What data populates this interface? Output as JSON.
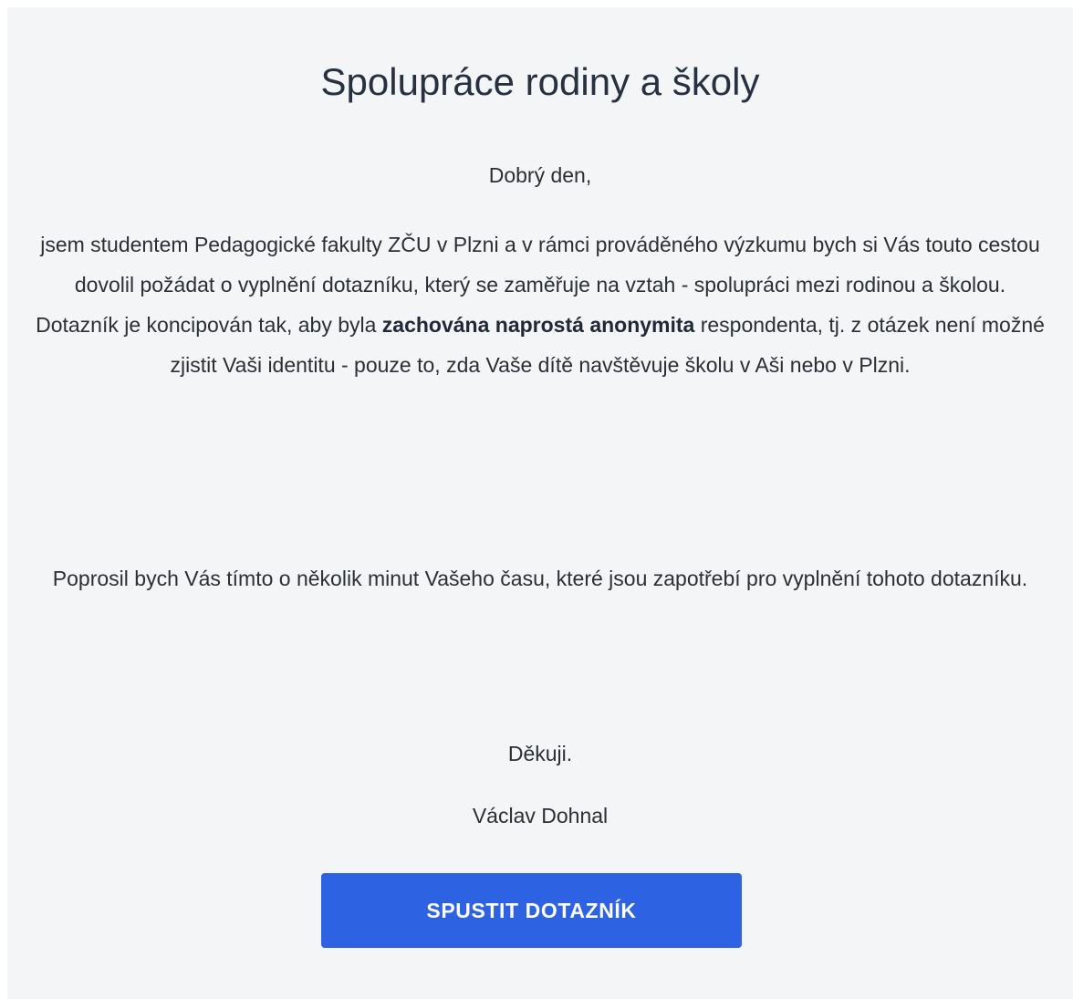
{
  "survey": {
    "title": "Spolupráce rodiny a školy",
    "greeting": "Dobrý den,",
    "intro_before_bold": "jsem studentem Pedagogické fakulty ZČU v Plzni a v rámci prováděného výzkumu bych si Vás touto cestou dovolil požádat o vyplnění dotazníku, který se zaměřuje na vztah - spolupráci mezi rodinou a školou. Dotazník je koncipován tak, aby byla ",
    "intro_bold": "zachována naprostá anonymita",
    "intro_after_bold": " respondenta, tj. z otázek není možné zjistit Vaši identitu - pouze to, zda Vaše dítě navštěvuje školu v Aši nebo v Plzni.",
    "request": "Poprosil bych Vás tímto o několik minut Vašeho času, které jsou zapotřebí pro vyplnění tohoto dotazníku.",
    "thanks": "Děkuji.",
    "signature": "Václav Dohnal",
    "start_button_label": "SPUSTIT DOTAZNÍK"
  },
  "colors": {
    "card_background": "#f4f5f6",
    "title_text": "#283142",
    "body_text": "#2b2f36",
    "button_background": "#2d63e2",
    "button_text": "#ffffff"
  }
}
